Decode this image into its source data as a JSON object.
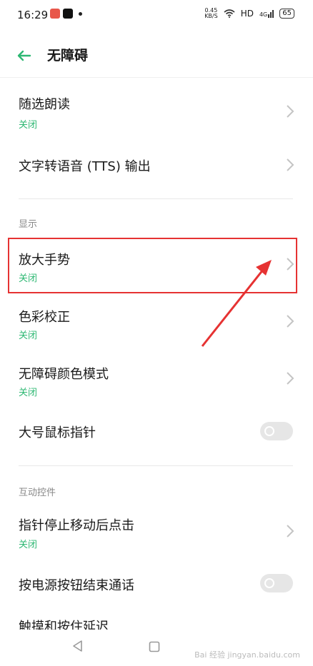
{
  "status": {
    "time": "16:29",
    "net_speed_value": "0.45",
    "net_speed_unit": "KB/S",
    "hd": "HD",
    "signal": "4G",
    "battery": "65"
  },
  "header": {
    "title": "无障碍"
  },
  "items": {
    "select_to_speak": {
      "title": "随选朗读",
      "status": "关闭"
    },
    "tts_output": {
      "title": "文字转语音 (TTS) 输出"
    },
    "section_display": "显示",
    "magnification": {
      "title": "放大手势",
      "status": "关闭"
    },
    "color_correction": {
      "title": "色彩校正",
      "status": "关闭"
    },
    "accessible_color_mode": {
      "title": "无障碍颜色模式",
      "status": "关闭"
    },
    "large_pointer": {
      "title": "大号鼠标指针",
      "toggle": false
    },
    "section_interaction": "互动控件",
    "dwell_click": {
      "title": "指针停止移动后点击",
      "status": "关闭"
    },
    "power_ends_call": {
      "title": "按电源按钮结束通话",
      "toggle": false
    },
    "touch_hold_delay": {
      "title": "触摸和按住延迟"
    }
  },
  "watermark": "Bai 经验  jingyan.baidu.com",
  "colors": {
    "accent": "#2eb873",
    "annotation": "#e63232"
  }
}
